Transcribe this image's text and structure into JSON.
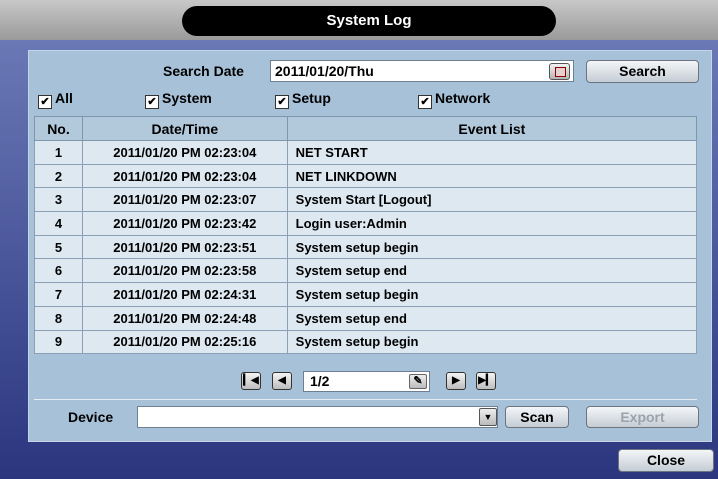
{
  "window": {
    "title": "System Log"
  },
  "search": {
    "date_label": "Search Date",
    "date_value": "2011/01/20/Thu",
    "calendar_icon": "calendar-icon",
    "search_label": "Search"
  },
  "filters": [
    {
      "label": "All",
      "checked": true
    },
    {
      "label": "System",
      "checked": true
    },
    {
      "label": "Setup",
      "checked": true
    },
    {
      "label": "Network",
      "checked": true
    }
  ],
  "table": {
    "headers": [
      "No.",
      "Date/Time",
      "Event List"
    ],
    "rows": [
      [
        "1",
        "2011/01/20 PM 02:23:04",
        "NET START"
      ],
      [
        "2",
        "2011/01/20 PM 02:23:04",
        "NET LINKDOWN"
      ],
      [
        "3",
        "2011/01/20 PM 02:23:07",
        "System Start [Logout]"
      ],
      [
        "4",
        "2011/01/20 PM 02:23:42",
        "Login user:Admin"
      ],
      [
        "5",
        "2011/01/20 PM 02:23:51",
        "System setup begin"
      ],
      [
        "6",
        "2011/01/20 PM 02:23:58",
        "System setup end"
      ],
      [
        "7",
        "2011/01/20 PM 02:24:31",
        "System setup begin"
      ],
      [
        "8",
        "2011/01/20 PM 02:24:48",
        "System setup end"
      ],
      [
        "9",
        "2011/01/20 PM 02:25:16",
        "System setup begin"
      ]
    ]
  },
  "pager": {
    "page": "1/2",
    "first_icon": "first-page-icon",
    "prev_icon": "prev-page-icon",
    "next_icon": "next-page-icon",
    "last_icon": "last-page-icon",
    "edit_icon": "pencil-icon"
  },
  "device": {
    "label": "Device",
    "value": "",
    "scan_label": "Scan",
    "export_label": "Export",
    "export_enabled": false
  },
  "footer": {
    "close_label": "Close"
  },
  "colors": {
    "panel": "#a7c2d8",
    "header": "#b2c8db",
    "row": "#dde8f1",
    "frame": "#3b4690"
  }
}
